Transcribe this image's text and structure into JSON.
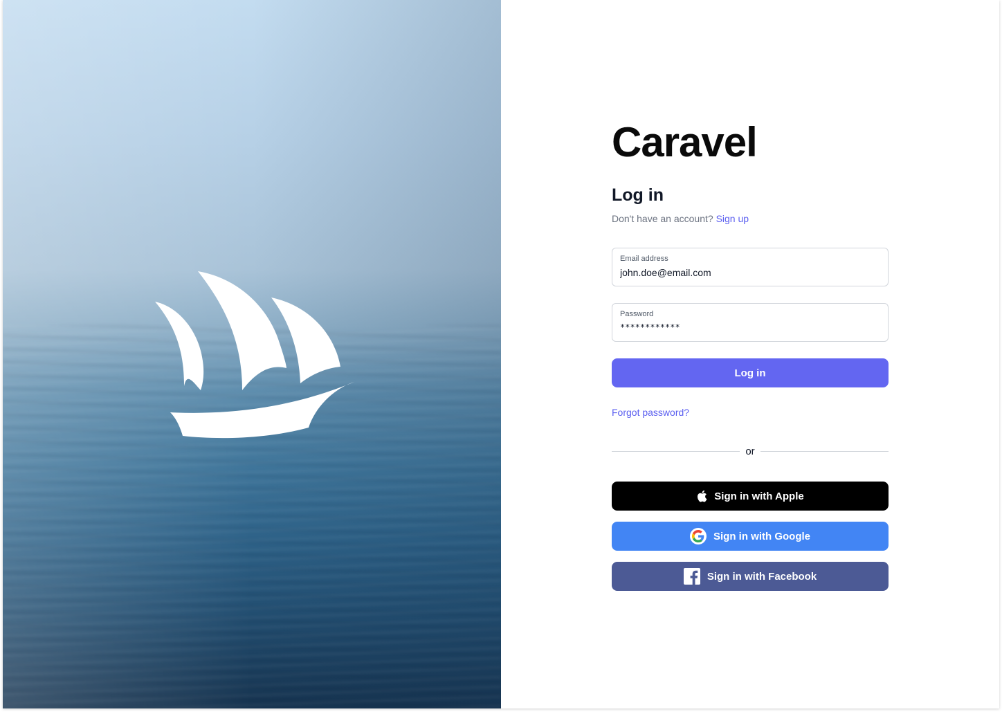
{
  "brand": {
    "name": "Caravel",
    "logo_icon": "sailing-ship-icon"
  },
  "login": {
    "heading": "Log in",
    "no_account_text": "Don't have an account?",
    "signup_link": "Sign up",
    "email": {
      "label": "Email address",
      "value": "john.doe@email.com"
    },
    "password": {
      "label": "Password",
      "value": "************"
    },
    "submit_label": "Log in",
    "forgot_link": "Forgot password?",
    "divider_text": "or"
  },
  "social": {
    "apple": {
      "label": "Sign in with Apple",
      "icon": "apple-icon",
      "color": "#000000"
    },
    "google": {
      "label": "Sign in with Google",
      "icon": "google-icon",
      "color": "#4285f4"
    },
    "facebook": {
      "label": "Sign in with Facebook",
      "icon": "facebook-icon",
      "color": "#4c5a95"
    }
  },
  "colors": {
    "accent": "#6366f1",
    "link": "#5b5ff0"
  }
}
